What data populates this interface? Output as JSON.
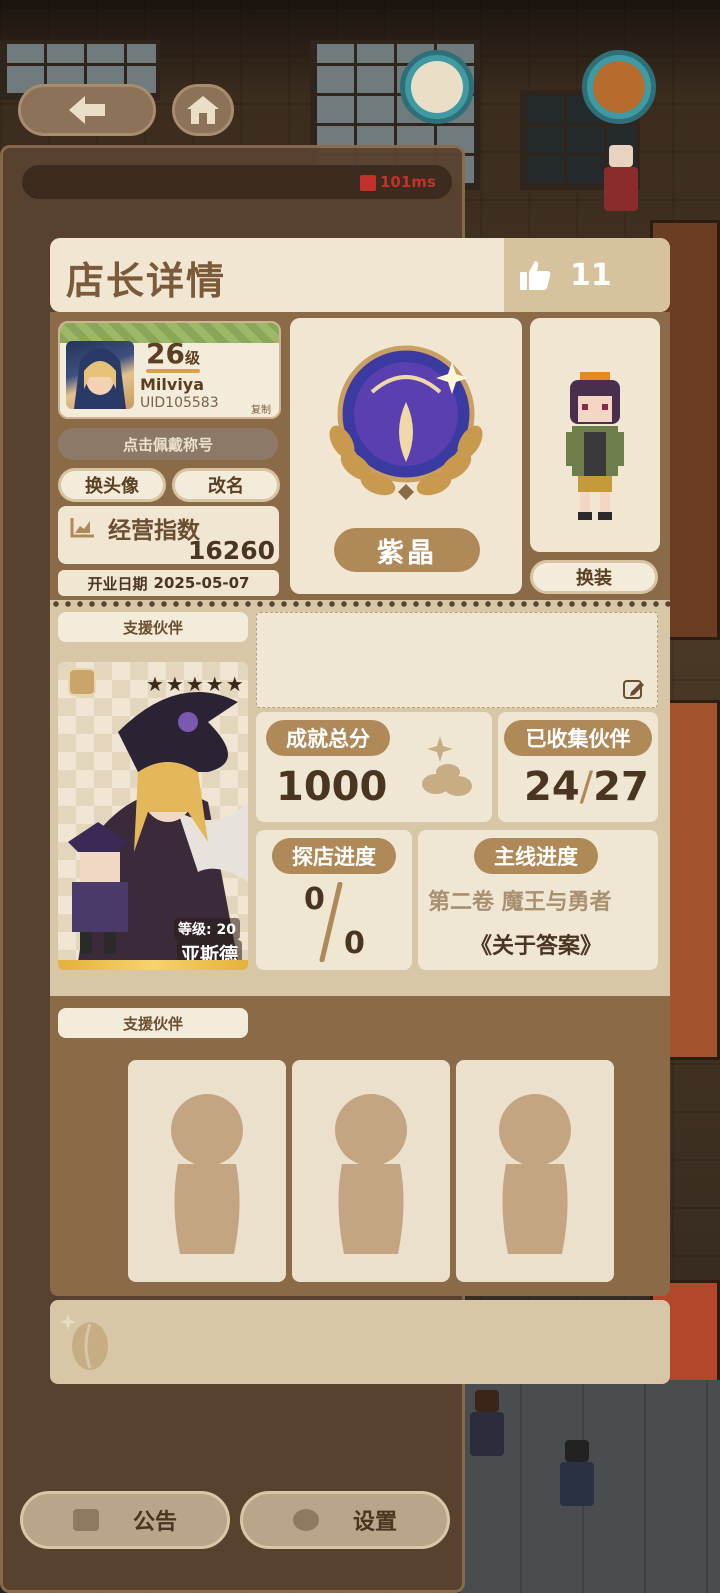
{
  "status": {
    "ping": "101ms"
  },
  "header": {
    "title": "店长详情",
    "likes": "11"
  },
  "profile": {
    "level": "26",
    "level_unit": "级",
    "name": "Milviya",
    "uid": "UID105583",
    "copy_label": "复制",
    "title_button": "点击佩戴称号",
    "change_avatar": "换头像",
    "rename": "改名",
    "index_label": "经营指数",
    "index_value": "16260",
    "open_label": "开业日期",
    "open_date": "2025-05-07"
  },
  "rank": {
    "label": "紫晶"
  },
  "character": {
    "change_outfit": "换装"
  },
  "support": {
    "tab_label": "支援伙伴",
    "stars": "★★★★★",
    "level_text": "等级: 20",
    "name": "亚斯德"
  },
  "stats": {
    "achievement_label": "成就总分",
    "achievement_value": "1000",
    "collected_label": "已收集伙伴",
    "collected_current": "24",
    "collected_total": "27",
    "collected_sep": "/",
    "visit_label": "探店进度",
    "visit_current": "0",
    "visit_total": "0",
    "main_label": "主线进度",
    "main_chapter": "第二卷 魔王与勇者",
    "main_title": "《关于答案》"
  },
  "team": {
    "tab_label": "支援伙伴"
  },
  "bottom_nav": {
    "notice": "公告",
    "settings": "设置"
  },
  "colors": {
    "panel_cream": "#f0e6d2",
    "panel_brown": "#8b6a47",
    "accent_tan": "#b08958",
    "text_brown": "#4a3520"
  }
}
